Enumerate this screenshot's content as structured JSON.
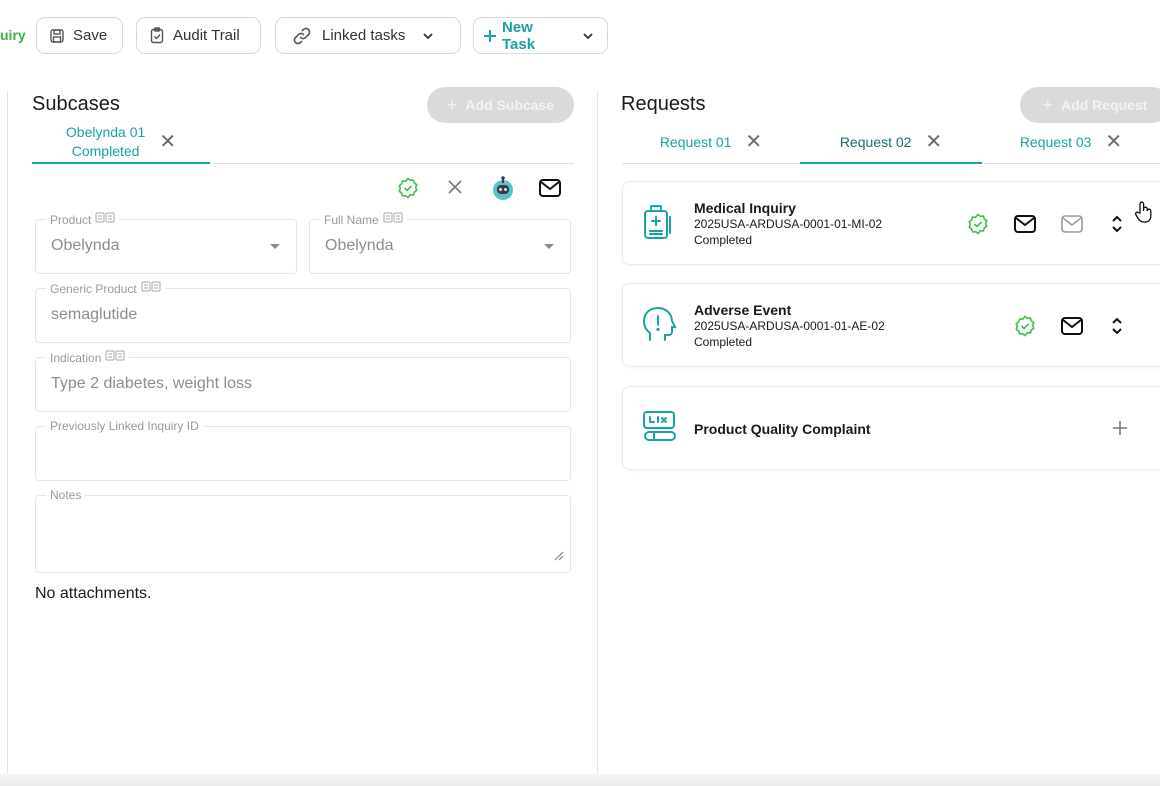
{
  "toolbar": {
    "cut_label": "uiry",
    "save_label": "Save",
    "audit_label": "Audit Trail",
    "linked_label": "Linked tasks",
    "new_task_label": "New Task"
  },
  "subcases": {
    "title": "Subcases",
    "add_label": "Add Subcase",
    "tab": {
      "name": "Obelynda 01",
      "status": "Completed"
    },
    "form": {
      "product": {
        "label": "Product",
        "value": "Obelynda"
      },
      "full_name": {
        "label": "Full Name",
        "value": "Obelynda"
      },
      "generic": {
        "label": "Generic Product",
        "value": "semaglutide"
      },
      "indication": {
        "label": "Indication",
        "value": "Type 2 diabetes, weight loss"
      },
      "prev_inquiry": {
        "label": "Previously Linked Inquiry ID",
        "value": ""
      },
      "notes": {
        "label": "Notes",
        "value": ""
      }
    },
    "no_attachments": "No attachments."
  },
  "requests": {
    "title": "Requests",
    "add_label": "Add Request",
    "tabs": [
      {
        "label": "Request 01"
      },
      {
        "label": "Request 02"
      },
      {
        "label": "Request 03"
      }
    ],
    "cards": [
      {
        "title": "Medical Inquiry",
        "id": "2025USA-ARDUSA-0001-01-MI-02",
        "status": "Completed"
      },
      {
        "title": "Adverse Event",
        "id": "2025USA-ARDUSA-0001-01-AE-02",
        "status": "Completed"
      },
      {
        "title": "Product Quality Complaint"
      }
    ]
  },
  "colors": {
    "accent": "#1aa3a3",
    "success": "#3cc04a",
    "disabled_pill": "#dadada"
  }
}
